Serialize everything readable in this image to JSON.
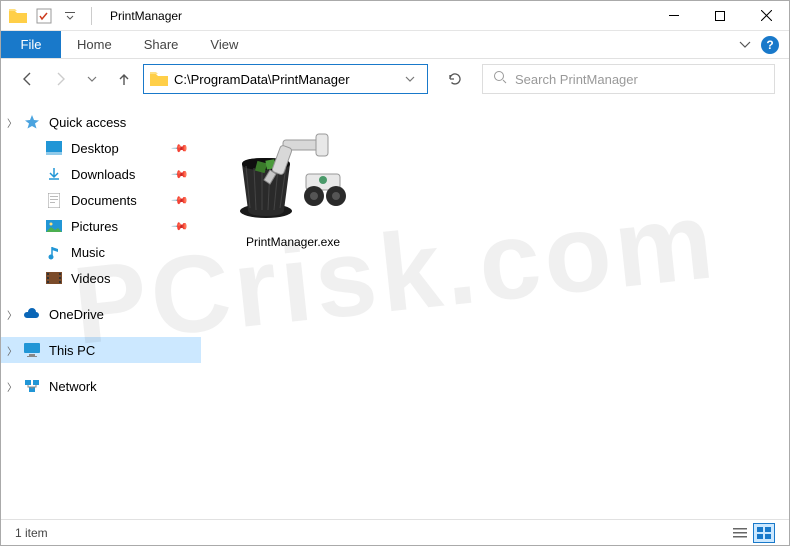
{
  "window": {
    "title": "PrintManager"
  },
  "ribbon": {
    "file": "File",
    "tabs": [
      "Home",
      "Share",
      "View"
    ]
  },
  "address": {
    "path": "C:\\ProgramData\\PrintManager"
  },
  "search": {
    "placeholder": "Search PrintManager"
  },
  "nav": {
    "quick_access": "Quick access",
    "items": [
      {
        "label": "Desktop",
        "icon": "desktop",
        "pinned": true
      },
      {
        "label": "Downloads",
        "icon": "downloads",
        "pinned": true
      },
      {
        "label": "Documents",
        "icon": "documents",
        "pinned": true
      },
      {
        "label": "Pictures",
        "icon": "pictures",
        "pinned": true
      },
      {
        "label": "Music",
        "icon": "music",
        "pinned": false
      },
      {
        "label": "Videos",
        "icon": "videos",
        "pinned": false
      }
    ],
    "onedrive": "OneDrive",
    "this_pc": "This PC",
    "network": "Network"
  },
  "content": {
    "files": [
      {
        "name": "PrintManager.exe"
      }
    ]
  },
  "status": {
    "count": "1 item"
  },
  "watermark": "PCrisk.com"
}
